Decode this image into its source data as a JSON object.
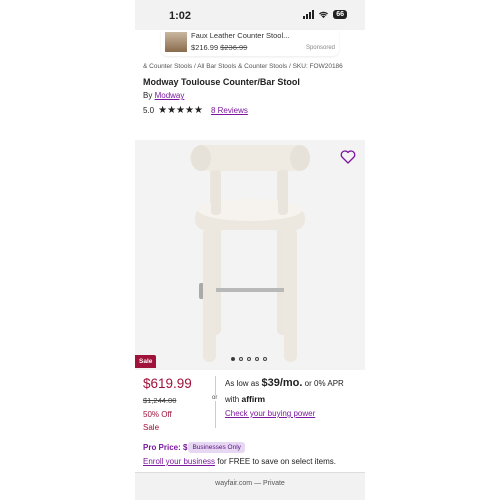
{
  "status_bar": {
    "time": "1:02",
    "battery": "66"
  },
  "ad": {
    "title": "Faux Leather Counter Stool...",
    "price": "$216.99",
    "original_price": "$236.99",
    "sponsored_label": "Sponsored"
  },
  "breadcrumb": "& Counter Stools  /  All Bar Stools & Counter Stools  /  SKU: FOW20186",
  "product": {
    "title": "Modway Toulouse Counter/Bar Stool",
    "by_label": "By",
    "brand": "Modway",
    "rating": "5.0",
    "stars": "★★★★★",
    "reviews": "8 Reviews"
  },
  "gallery": {
    "heart_icon": "heart-outline-icon",
    "dot_count": 5,
    "active_dot": 0,
    "sale_tag": "Sale"
  },
  "pricing": {
    "price": "$619.99",
    "was_price": "$1,244.00",
    "percent_off": "50% Off",
    "sale_label": "Sale",
    "or_label": "or",
    "as_low_as": "As low as",
    "monthly": "$39/mo.",
    "apr": "or 0% APR",
    "with_label": "with",
    "affirm_logo": "affirm",
    "check_power": "Check your buying power"
  },
  "pro": {
    "label": "Pro Price:",
    "dollar": "$",
    "badge": "Businesses Only",
    "enroll_link": "Enroll your business",
    "enroll_text": " for FREE to save on select items."
  },
  "url_bar": {
    "text": "wayfair.com — Private"
  },
  "colors": {
    "accent": "#7b189f",
    "sale": "#9f1239"
  }
}
